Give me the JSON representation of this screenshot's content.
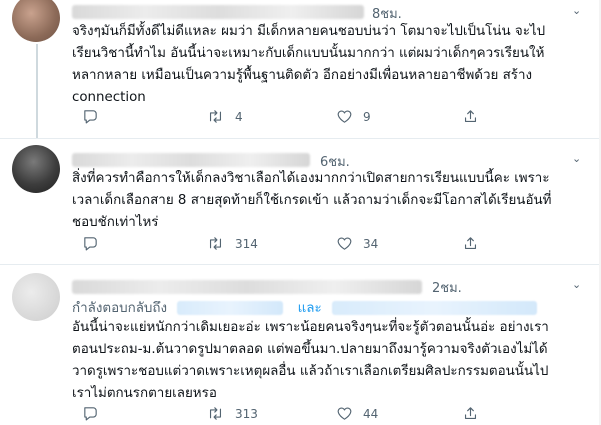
{
  "tweets": [
    {
      "time": "8ชม.",
      "text": "จริงๆมันก็มีทั้งดีไม่ดีแหละ ผมว่า มีเด็กหลายคนชอบบ่นว่า โตมาจะไปเป็นโน่น จะไป\nเรียนวิชานี้ทำไม อันนี้น่าจะเหมาะกับเด็กแบบนั้นมากกว่า แต่ผมว่าเด็กๆควรเรียนให้\nหลากหลาย เหมือนเป็นความรู้พื้นฐานติดตัว อีกอย่างมีเพื่อนหลายอาชีพด้วย สร้าง\nconnection",
      "retweets": "4",
      "likes": "9"
    },
    {
      "time": "6ชม.",
      "text": "สิ่งที่ควรทำคือการให้เด็กลงวิชาเลือกได้เองมากกว่าเปิดสายการเรียนแบบนี้คะ เพราะ\nเวลาเด็กเลือกสาย 8 สายสุดท้ายก็ใช้เกรดเข้า แล้วถามว่าเด็กจะมีโอกาสได้เรียนอันที่\nชอบชักเท่าไหร่",
      "retweets": "314",
      "likes": "34"
    },
    {
      "time": "2ชม.",
      "reply_prefix": "กำลังตอบกลับถึง",
      "reply_and": "และ",
      "text": "อันนี้น่าจะแย่หนักกว่าเดิมเยอะอ่ะ เพราะน้อยคนจริงๆนะที่จะรู้ตัวตอนนั้นอ่ะ อย่างเรา\nตอนประถม-ม.ต้นวาดรูปมาตลอด แต่พอขึ้นมา.ปลายมาถึงมารู้ความจริงตัวเองไม่ได้\nวาดรูเพราะชอบแต่วาดเพราะเหตุผลอื่น แล้วถ้าเราเลือกเตรียมศิลปะกรรมตอนนั้นไป\nเราไม่ตกนรกตายเลยหรอ",
      "retweets": "313",
      "likes": "44"
    }
  ],
  "icons": {
    "reply": "reply-icon",
    "retweet": "retweet-icon",
    "like": "heart-icon",
    "share": "share-icon",
    "more": "chevron-down-icon"
  },
  "colors": {
    "link": "#1d9bf0",
    "muted": "#536471",
    "text": "#0f1419"
  }
}
